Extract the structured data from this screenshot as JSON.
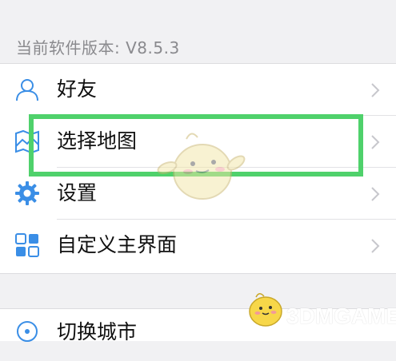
{
  "version": {
    "text": "当前软件版本: V8.5.3"
  },
  "menu": {
    "items": [
      {
        "label": "好友",
        "icon": "friends-icon"
      },
      {
        "label": "选择地图",
        "icon": "map-icon"
      },
      {
        "label": "设置",
        "icon": "gear-icon"
      },
      {
        "label": "自定义主界面",
        "icon": "grid-icon"
      }
    ]
  },
  "menu2": {
    "partial_label": "切换城市"
  },
  "watermark": {
    "text": "3DMGAME"
  },
  "colors": {
    "accent_blue": "#3a8ee6",
    "highlight_green": "#4fd16b",
    "background": "#f1f1f3"
  }
}
